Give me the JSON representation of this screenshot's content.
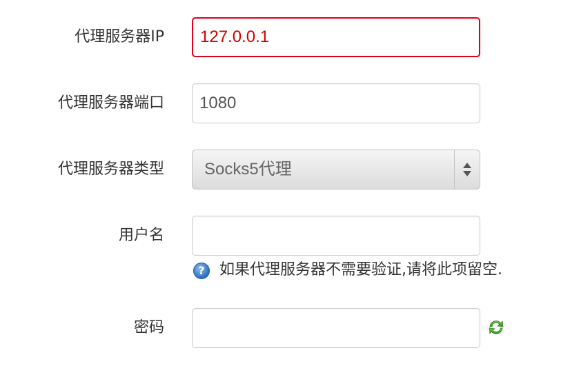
{
  "form": {
    "proxy_ip": {
      "label": "代理服务器IP",
      "value": "127.0.0.1",
      "invalid_color": "#e0001b"
    },
    "proxy_port": {
      "label": "代理服务器端口",
      "value": "1080"
    },
    "proxy_type": {
      "label": "代理服务器类型",
      "selected": "Socks5代理"
    },
    "username": {
      "label": "用户名",
      "value": "",
      "hint": "如果代理服务器不需要验证,请将此项留空."
    },
    "password": {
      "label": "密码",
      "value": ""
    }
  },
  "icons": {
    "help": "question-help-icon",
    "refresh": "refresh-icon"
  }
}
